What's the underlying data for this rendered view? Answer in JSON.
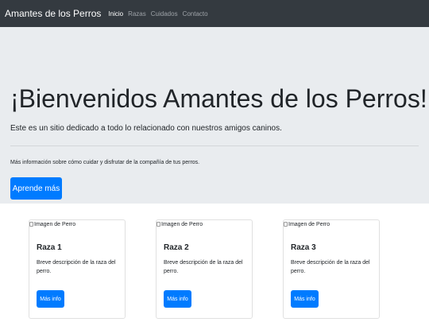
{
  "navbar": {
    "brand": "Amantes de los Perros",
    "links": [
      {
        "label": "Inicio",
        "active": true
      },
      {
        "label": "Razas",
        "active": false
      },
      {
        "label": "Cuidados",
        "active": false
      },
      {
        "label": "Contacto",
        "active": false
      }
    ]
  },
  "jumbotron": {
    "title": "¡Bienvenidos Amantes de los Perros!",
    "lead": "Este es un sitio dedicado a todo lo relacionado con nuestros amigos caninos.",
    "text": "Más información sobre cómo cuidar y disfrutar de la compañía de tus perros.",
    "button_label": "Aprende más"
  },
  "cards": [
    {
      "image_alt": "Imagen de Perro",
      "title": "Raza 1",
      "text": "Breve descripción de la raza del perro.",
      "button_label": "Más info"
    },
    {
      "image_alt": "Imagen de Perro",
      "title": "Raza 2",
      "text": "Breve descripción de la raza del perro.",
      "button_label": "Más info"
    },
    {
      "image_alt": "Imagen de Perro",
      "title": "Raza 3",
      "text": "Breve descripción de la raza del perro.",
      "button_label": "Más info"
    }
  ],
  "colors": {
    "navbar_bg": "#343a40",
    "jumbotron_bg": "#e9ecef",
    "primary": "#007bff"
  }
}
